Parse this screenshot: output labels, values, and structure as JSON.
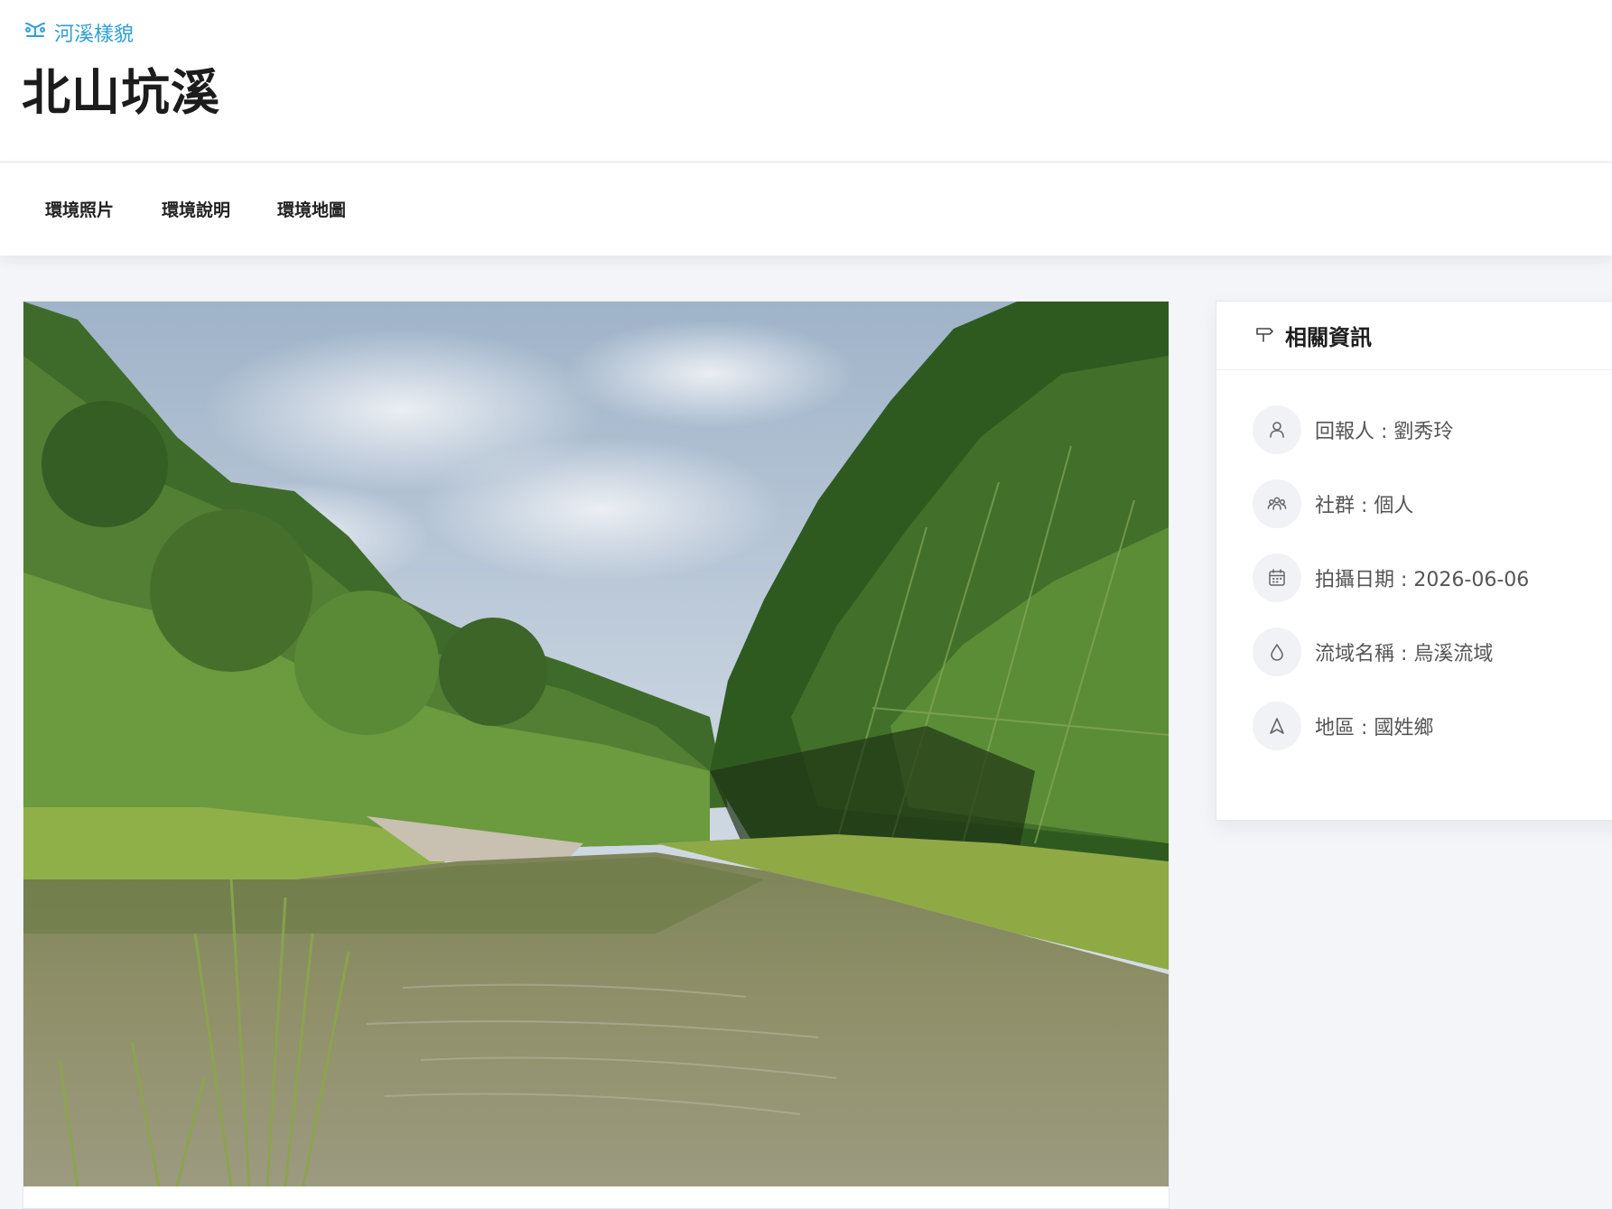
{
  "header": {
    "breadcrumb": "河溪樣貌",
    "title": "北山坑溪"
  },
  "tabs": [
    {
      "label": "環境照片"
    },
    {
      "label": "環境說明"
    },
    {
      "label": "環境地圖"
    }
  ],
  "info": {
    "title": "相關資訊",
    "rows": [
      {
        "icon": "user-icon",
        "text": "回報人 : 劉秀玲"
      },
      {
        "icon": "group-icon",
        "text": "社群 : 個人"
      },
      {
        "icon": "calendar-icon",
        "text": "拍攝日期 : 2026-06-06"
      },
      {
        "icon": "water-drop-icon",
        "text": "流域名稱 : 烏溪流域"
      },
      {
        "icon": "navigation-icon",
        "text": "地區 : 國姓鄉"
      }
    ]
  },
  "colors": {
    "accent": "#2f9fd6",
    "background": "#f4f5f9"
  }
}
